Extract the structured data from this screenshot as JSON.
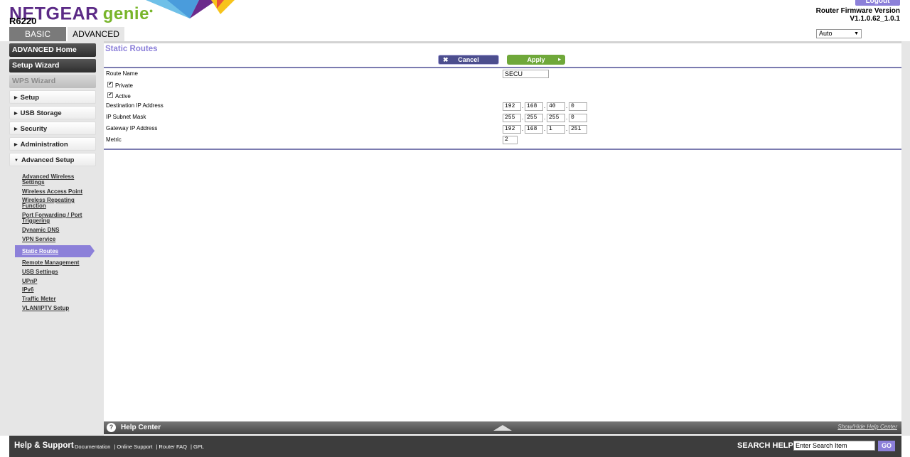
{
  "header": {
    "brand": "NETGEAR",
    "product": "genie",
    "model": "R6220",
    "logout_label": "Logout",
    "firmware_label": "Router Firmware Version",
    "firmware_version": "V1.1.0.62_1.0.1",
    "tabs": [
      {
        "label": "BASIC",
        "active": false
      },
      {
        "label": "ADVANCED",
        "active": true
      }
    ],
    "language": "Auto"
  },
  "sidebar": {
    "buttons": [
      {
        "label": "ADVANCED Home"
      },
      {
        "label": "Setup Wizard"
      },
      {
        "label": "WPS Wizard",
        "disabled": true
      }
    ],
    "sections": [
      {
        "label": "Setup",
        "expanded": false
      },
      {
        "label": "USB Storage",
        "expanded": false
      },
      {
        "label": "Security",
        "expanded": false
      },
      {
        "label": "Administration",
        "expanded": false
      },
      {
        "label": "Advanced Setup",
        "expanded": true
      }
    ],
    "submenu": [
      {
        "label": "Advanced Wireless Settings"
      },
      {
        "label": "Wireless Access Point"
      },
      {
        "label": "Wireless Repeating Function"
      },
      {
        "label": "Port Forwarding / Port Triggering"
      },
      {
        "label": "Dynamic DNS"
      },
      {
        "label": "VPN Service"
      },
      {
        "label": "Static Routes",
        "active": true
      },
      {
        "label": "Remote Management"
      },
      {
        "label": "USB Settings"
      },
      {
        "label": "UPnP"
      },
      {
        "label": "IPv6"
      },
      {
        "label": "Traffic Meter"
      },
      {
        "label": "VLAN/IPTV Setup"
      }
    ]
  },
  "main": {
    "title": "Static Routes",
    "cancel_label": "Cancel",
    "apply_label": "Apply",
    "route_name_label": "Route Name",
    "route_name_value": "SECU",
    "private_label": "Private",
    "private_checked": true,
    "active_label": "Active",
    "active_checked": true,
    "dest_ip_label": "Destination IP Address",
    "dest_ip": [
      "192",
      "168",
      "40",
      "0"
    ],
    "subnet_label": "IP Subnet Mask",
    "subnet": [
      "255",
      "255",
      "255",
      "0"
    ],
    "gateway_label": "Gateway IP Address",
    "gateway": [
      "192",
      "168",
      "1",
      "251"
    ],
    "metric_label": "Metric",
    "metric_value": "2"
  },
  "help_center": {
    "title": "Help Center",
    "toggle_label": "Show/Hide Help Center"
  },
  "footer": {
    "title": "Help & Support",
    "links": [
      "Documentation",
      "Online Support",
      "Router FAQ",
      "GPL"
    ],
    "search_label": "SEARCH HELP",
    "search_placeholder": "Enter Search Item",
    "go_label": "GO"
  },
  "colors": {
    "accent": "#8c80d9",
    "apply_green": "#6fa83a",
    "brand_purple": "#5b2a86"
  }
}
